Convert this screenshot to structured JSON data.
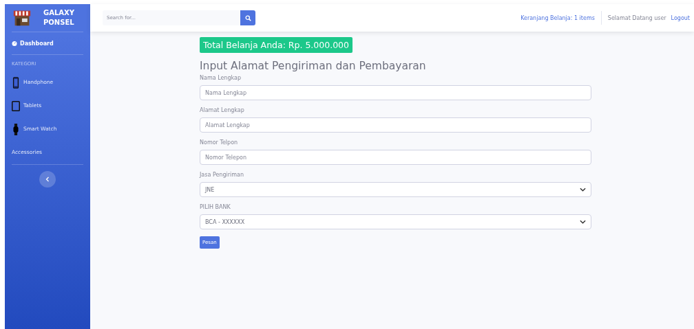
{
  "brand": {
    "line_1": "GALAXY",
    "line_2": "PONSEL"
  },
  "sidebar": {
    "dashboard": {
      "label": "Dashboard",
      "selected": true
    },
    "heading": "KATEGORI",
    "items": [
      {
        "label": "Handphone",
        "kind": "phone"
      },
      {
        "label": "Tablets",
        "kind": "tablet"
      },
      {
        "label": "Smart Watch",
        "kind": "watch"
      },
      {
        "label": "Accessories",
        "kind": "plain"
      }
    ]
  },
  "topbar": {
    "search": {
      "placeholder": "Search for..."
    },
    "cart": "Keranjang Belanja: 1 items",
    "greeting": "Selamat Datang user",
    "logout": "Logout"
  },
  "total": "Total Belanja Anda: Rp. 5.000.000",
  "form": {
    "title": "Input Alamat Pengiriman dan Pembayaran",
    "fields": [
      {
        "label": "Nama Lengkap",
        "kind": "text",
        "placeholder": "Nama Lengkap"
      },
      {
        "label": "Alamat Lengkap",
        "kind": "text",
        "placeholder": "Alamat Lengkap"
      },
      {
        "label": "Nomor Telpon",
        "kind": "text",
        "placeholder": "Nomor Telepon"
      },
      {
        "label": "Jasa Pengiriman",
        "kind": "select",
        "value": "JNE"
      },
      {
        "label": "PILIH BANK",
        "kind": "select",
        "value": "BCA - XXXXXX"
      }
    ],
    "submit": "Pesan"
  }
}
